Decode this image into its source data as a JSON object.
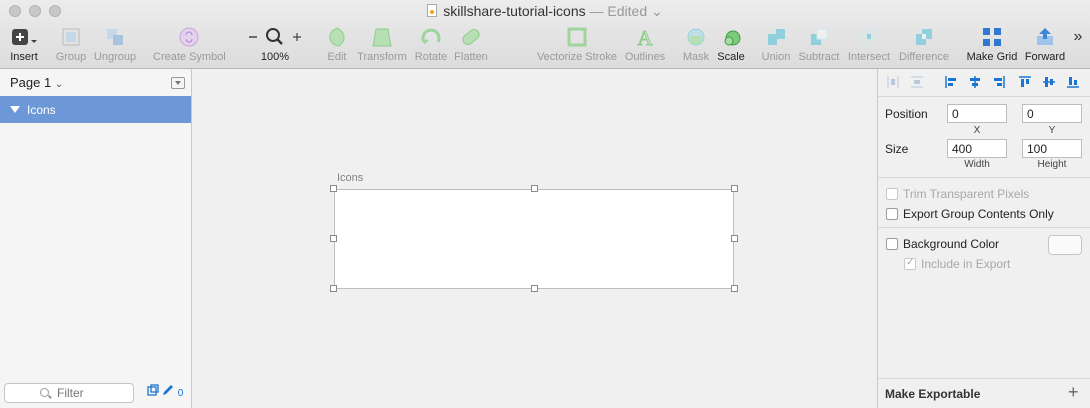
{
  "window": {
    "title": "skillshare-tutorial-icons",
    "status": "— Edited"
  },
  "toolbar": {
    "insert": "Insert",
    "group": "Group",
    "ungroup": "Ungroup",
    "create_symbol": "Create Symbol",
    "zoom": "100%",
    "edit": "Edit",
    "transform": "Transform",
    "rotate": "Rotate",
    "flatten": "Flatten",
    "vectorize_stroke": "Vectorize Stroke",
    "outlines": "Outlines",
    "mask": "Mask",
    "scale": "Scale",
    "union": "Union",
    "subtract": "Subtract",
    "intersect": "Intersect",
    "difference": "Difference",
    "make_grid": "Make Grid",
    "forward": "Forward",
    "overflow": "»"
  },
  "sidebar": {
    "page": "Page 1",
    "layers": [
      {
        "name": "Icons"
      }
    ],
    "filter_placeholder": "Filter",
    "count": "0"
  },
  "canvas": {
    "artboard_label": "Icons"
  },
  "inspector": {
    "position_label": "Position",
    "position_x": "0",
    "position_y": "0",
    "x_label": "X",
    "y_label": "Y",
    "size_label": "Size",
    "width": "400",
    "height": "100",
    "width_label": "Width",
    "height_label": "Height",
    "trim_transparent": "Trim Transparent Pixels",
    "export_group_contents": "Export Group Contents Only",
    "background_color": "Background Color",
    "include_in_export": "Include in Export",
    "make_exportable": "Make Exportable"
  },
  "colors": {
    "selection": "#6d98d7",
    "accent": "#1b75d2",
    "shape_green": "#7cc97c",
    "shape_teal": "#6fc6d6"
  }
}
